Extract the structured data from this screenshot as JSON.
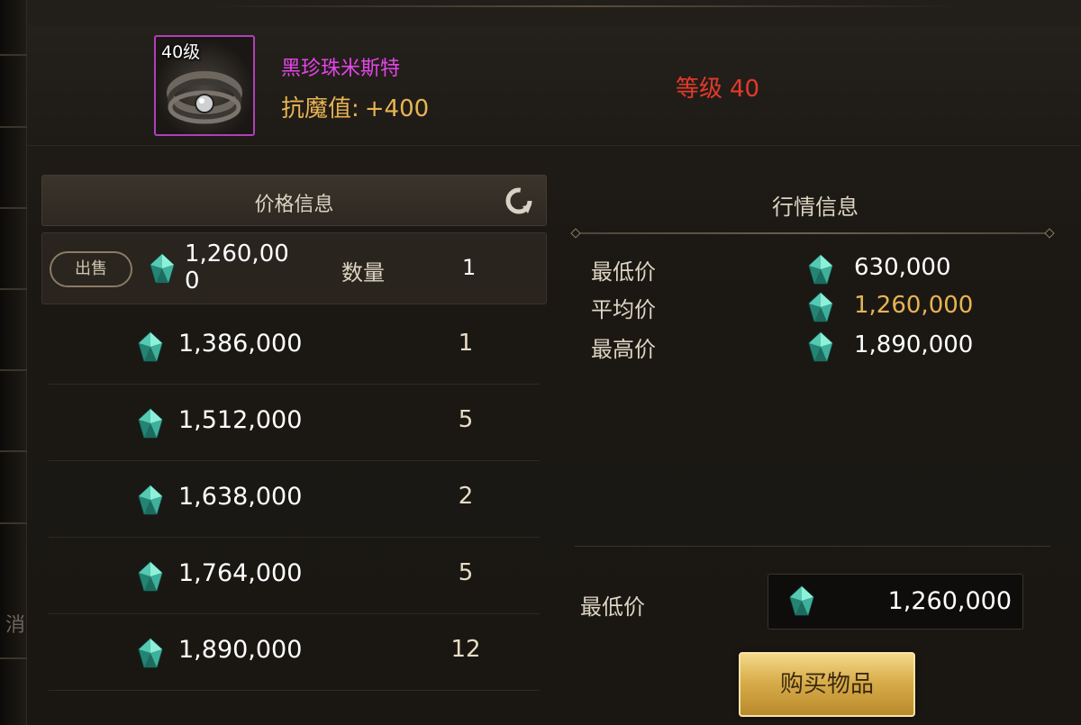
{
  "item": {
    "level_badge": "40级",
    "name": "黑珍珠米斯特",
    "stat_label": "抗魔值:",
    "stat_value": "+400",
    "required_level_label": "等级",
    "required_level_value": "40",
    "rarity_color": "#b03fb8",
    "icon": "ring-icon"
  },
  "price_info": {
    "title": "价格信息",
    "refresh_icon": "refresh-icon",
    "sell": {
      "button_label": "出售",
      "price": "1,260,000",
      "qty_label": "数量",
      "qty": "1"
    },
    "listings": [
      {
        "price": "1,386,000",
        "qty": "1"
      },
      {
        "price": "1,512,000",
        "qty": "5"
      },
      {
        "price": "1,638,000",
        "qty": "2"
      },
      {
        "price": "1,764,000",
        "qty": "5"
      },
      {
        "price": "1,890,000",
        "qty": "12"
      }
    ]
  },
  "market_info": {
    "title": "行情信息",
    "rows": [
      {
        "label": "最低价",
        "value": "630,000",
        "color": "#ffffff"
      },
      {
        "label": "平均价",
        "value": "1,260,000",
        "color": "#e8b452"
      },
      {
        "label": "最高价",
        "value": "1,890,000",
        "color": "#ffffff"
      }
    ]
  },
  "purchase": {
    "min_price_label": "最低价",
    "min_price_value": "1,260,000",
    "buy_button_label": "购买物品"
  },
  "side": {
    "partial_glyph": "消"
  },
  "currency_icon": "gem-icon",
  "colors": {
    "accent_gold": "#e8b452",
    "level_red": "#e33a2a",
    "name_purple": "#e446e8"
  }
}
